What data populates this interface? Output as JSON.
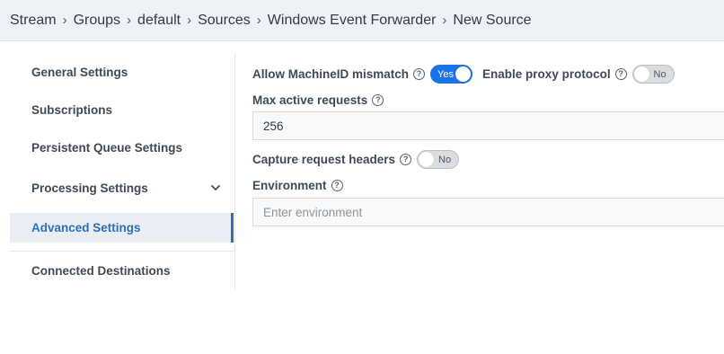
{
  "breadcrumb": [
    "Stream",
    "Groups",
    "default",
    "Sources",
    "Windows Event Forwarder",
    "New Source"
  ],
  "breadcrumb_separator": "›",
  "sidebar": {
    "items": [
      {
        "label": "General Settings"
      },
      {
        "label": "Subscriptions"
      },
      {
        "label": "Persistent Queue Settings"
      },
      {
        "label": "Processing Settings"
      },
      {
        "label": "Advanced Settings",
        "active": true
      },
      {
        "label": "Connected Destinations"
      }
    ]
  },
  "form": {
    "allow_machineid_mismatch": {
      "label": "Allow MachineID mismatch",
      "value": "Yes"
    },
    "enable_proxy_protocol": {
      "label": "Enable proxy protocol",
      "value": "No"
    },
    "max_active_requests": {
      "label": "Max active requests",
      "value": "256"
    },
    "capture_request_headers": {
      "label": "Capture request headers",
      "value": "No"
    },
    "environment": {
      "label": "Environment",
      "placeholder": "Enter environment",
      "value": ""
    }
  },
  "icons": {
    "help": "?",
    "chevron": "chevron-down-icon"
  },
  "colors": {
    "accent": "#1a73e8",
    "active_text": "#2c6fb4",
    "active_bg": "#e9eef4",
    "topbar_bg": "#eef2f6"
  }
}
